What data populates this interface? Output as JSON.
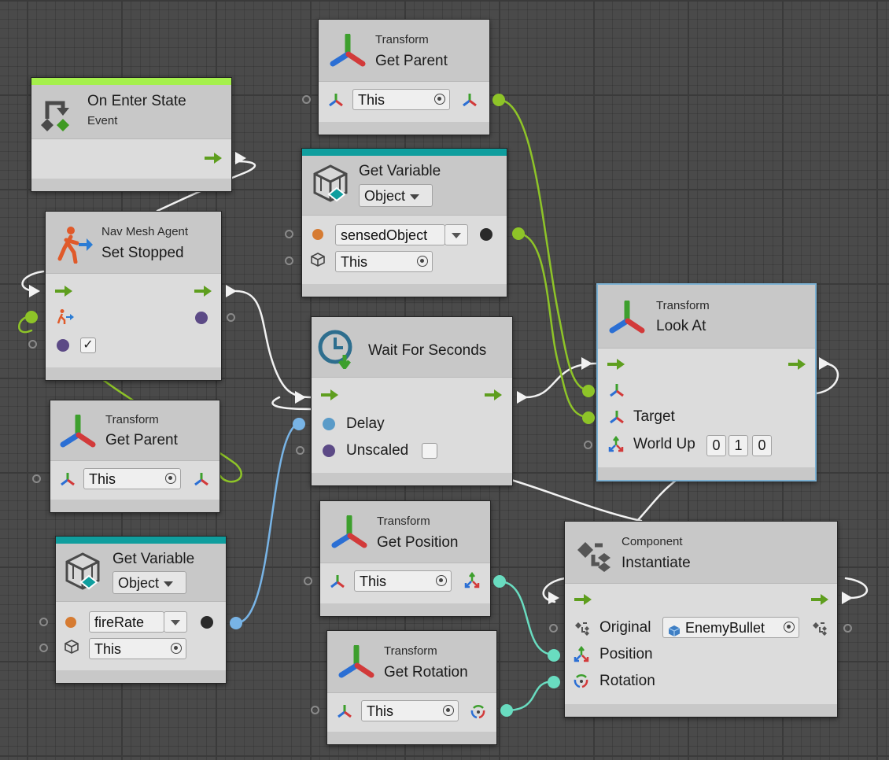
{
  "colors": {
    "flow": "#5e9e1e",
    "event_bar": "#a5f04c",
    "variable_bar": "#0f9e9e",
    "green_wire": "#8ec428",
    "blue_wire": "#78b4e6",
    "teal_wire": "#69dcc0",
    "white_wire": "#f2f2f2",
    "orange_dot": "#d67b32",
    "purple_dot": "#5c4a86",
    "blue_dot": "#5a9bc8",
    "black_dot": "#2a2a2a",
    "selection": "#7bb0d2"
  },
  "nodes": {
    "on_enter_state": {
      "title": "On Enter State",
      "subtitle": "Event",
      "icon": "state-transition-icon"
    },
    "transform_get_parent_top": {
      "subtitle": "Transform",
      "title": "Get Parent",
      "target_value": "This",
      "icon": "transform-axes-icon"
    },
    "get_variable_top": {
      "title": "Get Variable",
      "kind": "Object",
      "name_value": "sensedObject",
      "target_value": "This",
      "icon": "variable-cube-icon"
    },
    "nav_mesh_set_stopped": {
      "subtitle": "Nav Mesh Agent",
      "title": "Set Stopped",
      "checked": "✓",
      "icon": "nav-mesh-agent-icon"
    },
    "wait_for_seconds": {
      "title": "Wait For Seconds",
      "delay_label": "Delay",
      "unscaled_label": "Unscaled",
      "icon": "clock-wait-icon"
    },
    "transform_look_at": {
      "subtitle": "Transform",
      "title": "Look At",
      "target_label": "Target",
      "world_up_label": "World Up",
      "world_up": [
        "0",
        "1",
        "0"
      ],
      "icon": "transform-axes-icon"
    },
    "transform_get_parent_left": {
      "subtitle": "Transform",
      "title": "Get Parent",
      "target_value": "This",
      "icon": "transform-axes-icon"
    },
    "get_variable_left": {
      "title": "Get Variable",
      "kind": "Object",
      "name_value": "fireRate",
      "target_value": "This",
      "icon": "variable-cube-icon"
    },
    "transform_get_position": {
      "subtitle": "Transform",
      "title": "Get Position",
      "target_value": "This",
      "icon": "transform-axes-icon"
    },
    "transform_get_rotation": {
      "subtitle": "Transform",
      "title": "Get Rotation",
      "target_value": "This",
      "icon": "transform-axes-icon"
    },
    "component_instantiate": {
      "subtitle": "Component",
      "title": "Instantiate",
      "original_label": "Original",
      "original_value": "EnemyBullet",
      "position_label": "Position",
      "rotation_label": "Rotation",
      "icon": "component-prefab-icon"
    }
  }
}
